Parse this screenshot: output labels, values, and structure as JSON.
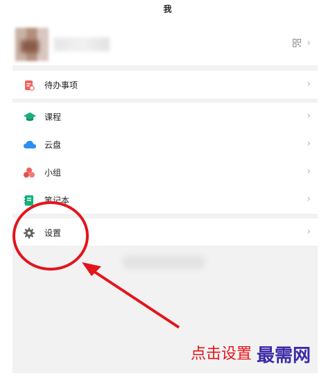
{
  "header": {
    "title": "我"
  },
  "profile": {
    "qr_icon": "qr-code-icon",
    "chevron": "›"
  },
  "menu": [
    {
      "label": "待办事项",
      "icon": "todo-icon",
      "color": "#f0625d"
    },
    {
      "label": "课程",
      "icon": "graduation-cap-icon",
      "color": "#18b07a"
    },
    {
      "label": "云盘",
      "icon": "cloud-icon",
      "color": "#2e8ef0"
    },
    {
      "label": "小组",
      "icon": "group-icon",
      "color": "#f0625d"
    },
    {
      "label": "笔记本",
      "icon": "notebook-icon",
      "color": "#18b07a"
    },
    {
      "label": "设置",
      "icon": "gear-icon",
      "color": "#666666"
    }
  ],
  "annotation": {
    "note": "点击设置",
    "brand": "最需网",
    "color": "#e3141c"
  }
}
